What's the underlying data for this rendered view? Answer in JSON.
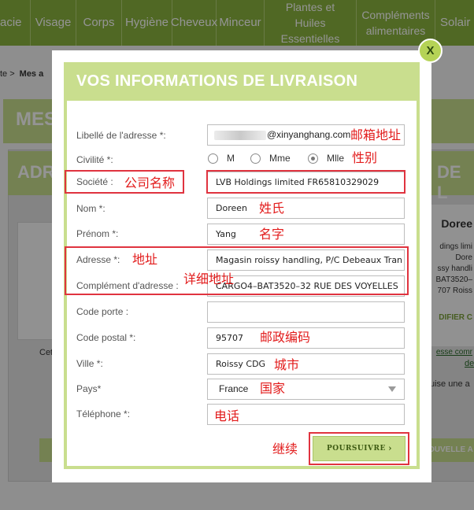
{
  "background": {
    "nav": [
      "acie",
      "Visage",
      "Corps",
      "Hygiène",
      "Cheveux",
      "Minceur",
      "Plantes et Huiles Essentielles",
      "Compléments alimentaires",
      "Solair"
    ],
    "breadcrumb_prefix": "te >",
    "breadcrumb_current": "Mes a",
    "section_title": "MES",
    "block_title_left": "ADR",
    "block_title_right": "DE L",
    "left_card_text": "Cet",
    "right_card_lines": [
      "Doree",
      "dings limi",
      "Dore",
      "ssy handli",
      "BAT3520–",
      "707 Roiss",
      "DIFIER C",
      "esse comr",
      "de",
      "uise une a"
    ],
    "right_button": "OUVELLE A"
  },
  "modal": {
    "close_label": "X",
    "title": "VOS INFORMATIONS DE LIVRAISON",
    "labels": {
      "libelle": "Libellé de l'adresse *:",
      "civilite": "Civilité *:",
      "societe": "Société :",
      "nom": "Nom *:",
      "prenom": "Prénom *:",
      "adresse": "Adresse *:",
      "complement": "Complément d'adresse :",
      "code_porte": "Code porte :",
      "code_postal": "Code postal *:",
      "ville": "Ville *:",
      "pays": "Pays*",
      "telephone": "Téléphone *:"
    },
    "values": {
      "libelle": "@xinyanghang.com",
      "societe": "LVB Holdings limited FR65810329029",
      "nom": "Doreen",
      "prenom": "Yang",
      "adresse": "Magasin roissy handling, P/C Debeaux Tran",
      "complement": "CARGO4–BAT3520–32 RUE DES VOYELLES",
      "code_porte": "",
      "code_postal": "95707",
      "ville": "Roissy CDG",
      "pays": "France",
      "telephone": ""
    },
    "civility_options": [
      {
        "label": "M",
        "checked": false
      },
      {
        "label": "Mme",
        "checked": false
      },
      {
        "label": "Mlle",
        "checked": true
      }
    ],
    "submit_label": "POURSUIVRE",
    "submit_arrow": "›"
  },
  "annotations": {
    "email": "邮箱地址",
    "gender": "性别",
    "company": "公司名称",
    "surname": "姓氏",
    "given_name": "名字",
    "address": "地址",
    "address_detail": "详细地址",
    "postal": "邮政编码",
    "city": "城市",
    "country": "国家",
    "phone": "电话",
    "continue": "继续"
  },
  "colors": {
    "nav_green": "#8ab43f",
    "modal_green": "#c9de8e",
    "annotation_red": "#e0333f"
  }
}
